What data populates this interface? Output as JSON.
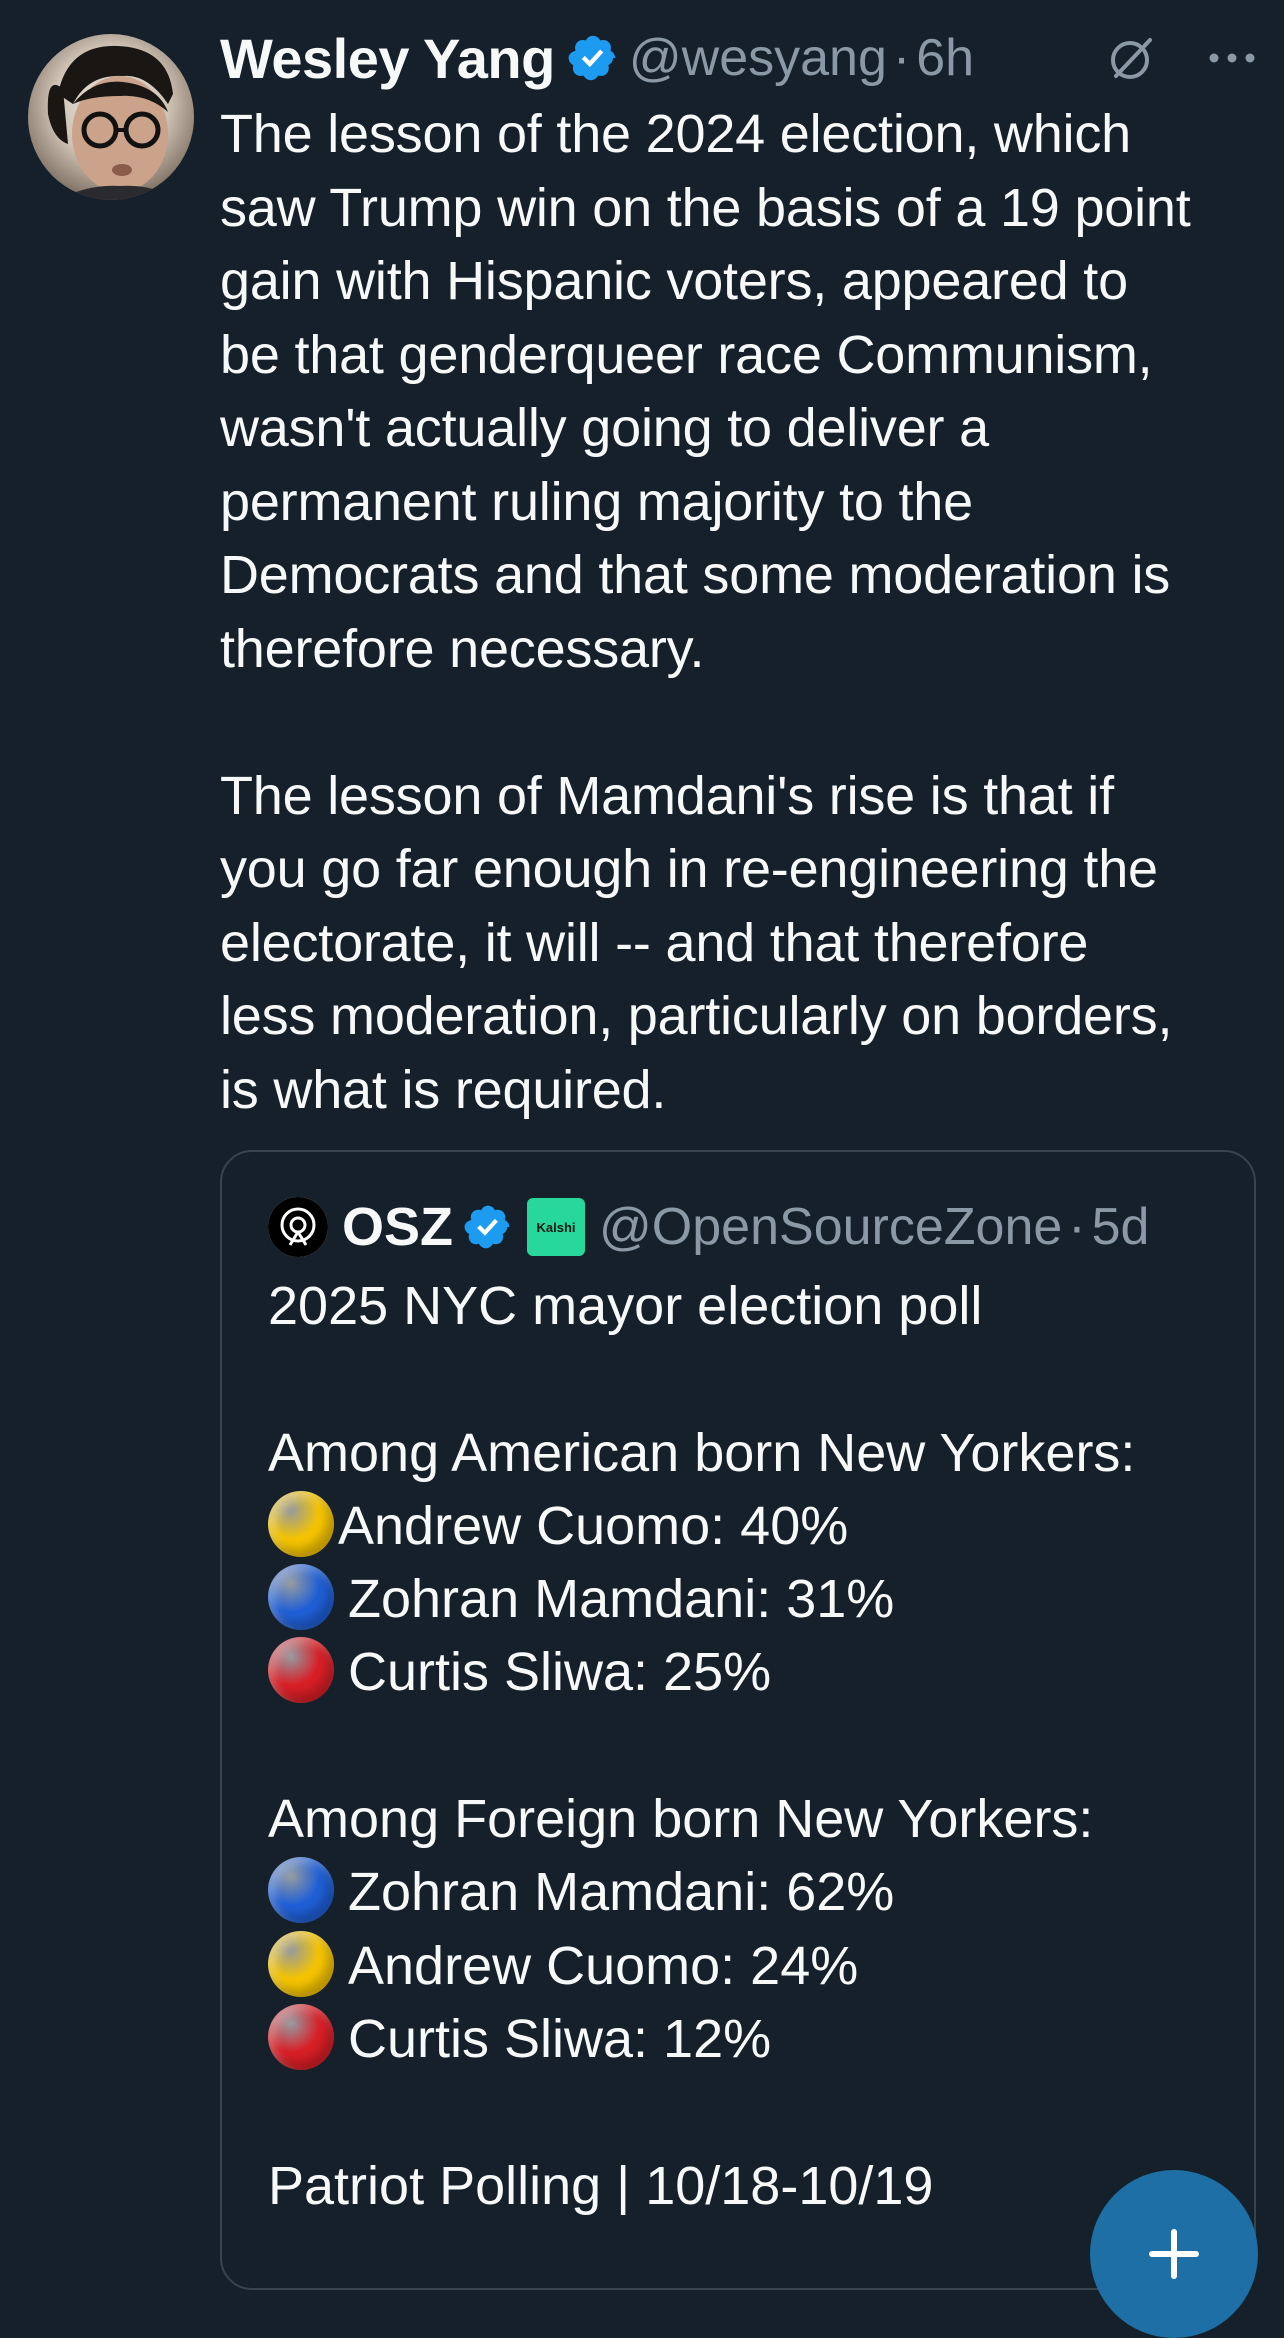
{
  "tweet": {
    "author": {
      "display_name": "Wesley Yang",
      "handle": "@wesyang",
      "verified": true
    },
    "separator": "·",
    "time": "6h",
    "text": "The lesson of the 2024 election, which\nsaw Trump win on the basis of a 19 point\ngain with Hispanic voters, appeared to\nbe that genderqueer race Communism,\nwasn't actually going to deliver a\npermanent ruling majority to the\nDemocrats and that some moderation is\ntherefore necessary.\n\nThe lesson of Mamdani's rise is that if\nyou go far enough in re-engineering the\nelectorate, it will -- and that therefore\nless moderation, particularly on borders,\nis what is required.",
    "actions": {
      "grok_icon": "grok-icon",
      "more_icon": "more-horizontal-icon"
    }
  },
  "quoted_tweet": {
    "author": {
      "display_name": "OSZ",
      "handle": "@OpenSourceZone",
      "verified": true,
      "affiliate_badge": "Kalshi"
    },
    "separator": "·",
    "time": "5d",
    "title": "2025 NYC mayor election poll",
    "sections": [
      {
        "heading": "Among American born New Yorkers:",
        "rows": [
          {
            "marker": "yellow",
            "color": "#f5c400",
            "text": "Andrew Cuomo: 40%"
          },
          {
            "marker": "blue",
            "color": "#1f5fd6",
            "text": "Zohran Mamdani: 31%"
          },
          {
            "marker": "red",
            "color": "#d81f26",
            "text": "Curtis Sliwa: 25%"
          }
        ]
      },
      {
        "heading": "Among Foreign born New Yorkers:",
        "rows": [
          {
            "marker": "blue",
            "color": "#1f5fd6",
            "text": "Zohran Mamdani: 62%"
          },
          {
            "marker": "yellow",
            "color": "#f5c400",
            "text": "Andrew Cuomo: 24%"
          },
          {
            "marker": "red",
            "color": "#d81f26",
            "text": "Curtis Sliwa: 12%"
          }
        ]
      }
    ],
    "source": "Patriot Polling | 10/18-10/19"
  },
  "theme": {
    "background": "#15202b",
    "text": "#f7f9f9",
    "secondary_text": "#8b98a5",
    "verified_blue": "#1d9bf0",
    "border": "#38444d",
    "fab": "#1d6fa5"
  },
  "fab": {
    "icon": "compose-plus-icon"
  }
}
